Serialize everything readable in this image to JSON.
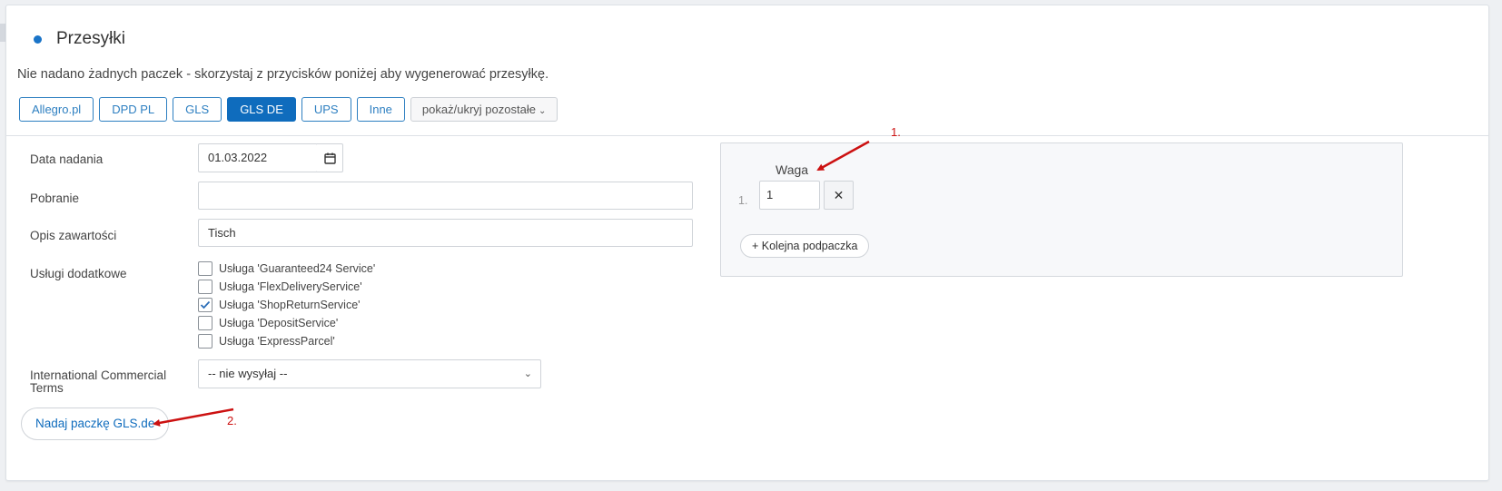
{
  "header": {
    "title": "Przesyłki"
  },
  "info_text": "Nie nadano żadnych paczek - skorzystaj z przycisków poniżej aby wygenerować przesyłkę.",
  "carriers": {
    "items": [
      "Allegro.pl",
      "DPD PL",
      "GLS",
      "GLS DE",
      "UPS",
      "Inne"
    ],
    "active": "GLS DE",
    "more_label": "pokaż/ukryj pozostałe"
  },
  "form": {
    "date_label": "Data nadania",
    "date_value": "01.03.2022",
    "cod_label": "Pobranie",
    "cod_value": "",
    "content_label": "Opis zawartości",
    "content_value": "Tisch",
    "services_label": "Usługi dodatkowe",
    "services": [
      {
        "label": "Usługa 'Guaranteed24 Service'",
        "checked": false
      },
      {
        "label": "Usługa 'FlexDeliveryService'",
        "checked": false
      },
      {
        "label": "Usługa 'ShopReturnService'",
        "checked": true
      },
      {
        "label": "Usługa 'DepositService'",
        "checked": false
      },
      {
        "label": "Usługa 'ExpressParcel'",
        "checked": false
      }
    ],
    "incoterms_label": "International Commercial Terms",
    "incoterms_value": "-- nie wysyłaj --",
    "submit_label": "Nadaj paczkę GLS.de"
  },
  "parcels": {
    "weight_label": "Waga",
    "rows": [
      {
        "num": "1.",
        "weight": "1"
      }
    ],
    "add_label": "+ Kolejna podpaczka"
  },
  "annotations": {
    "a1": "1.",
    "a2": "2."
  },
  "colors": {
    "accent": "#0f6cbd",
    "annotation": "#cc1111"
  }
}
